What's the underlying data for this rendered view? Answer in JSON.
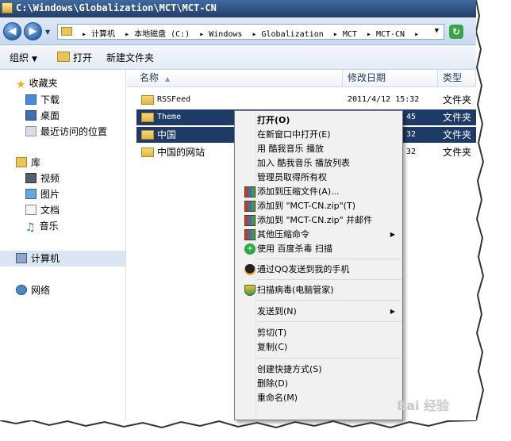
{
  "window": {
    "title": "C:\\Windows\\Globalization\\MCT\\MCT-CN"
  },
  "address_bar": {
    "crumbs": [
      "计算机",
      "本地磁盘 (C:)",
      "Windows",
      "Globalization",
      "MCT",
      "MCT-CN"
    ]
  },
  "toolbar": {
    "organize_label": "组织",
    "open_label": "打开",
    "new_folder_label": "新建文件夹"
  },
  "nav_pane": {
    "favorites": {
      "label": "收藏夹",
      "icon": "star-icon"
    },
    "favorites_items": [
      {
        "label": "下载",
        "icon": "downloads-icon"
      },
      {
        "label": "桌面",
        "icon": "desktop-icon"
      },
      {
        "label": "最近访问的位置",
        "icon": "recent-places-icon"
      }
    ],
    "libraries": {
      "label": "库",
      "icon": "library-icon"
    },
    "library_items": [
      {
        "label": "视频",
        "icon": "video-icon"
      },
      {
        "label": "图片",
        "icon": "picture-icon"
      },
      {
        "label": "文档",
        "icon": "document-icon"
      },
      {
        "label": "音乐",
        "icon": "music-icon"
      }
    ],
    "computer": {
      "label": "计算机",
      "icon": "computer-icon"
    },
    "network": {
      "label": "网络",
      "icon": "network-icon"
    }
  },
  "columns": {
    "name": "名称",
    "modified": "修改日期",
    "type": "类型"
  },
  "files": [
    {
      "name": "RSSFeed",
      "modified": "2011/4/12 15:32",
      "type": "文件夹",
      "selected": false
    },
    {
      "name": "Theme",
      "modified": "45",
      "type": "文件夹",
      "selected": true
    },
    {
      "name": "中国",
      "modified": "32",
      "type": "文件夹",
      "selected": true
    },
    {
      "name": "中国的网站",
      "modified": "32",
      "type": "文件夹",
      "selected": false
    }
  ],
  "context_menu": {
    "items": [
      {
        "label": "打开(O)",
        "bold": true
      },
      {
        "label": "在新窗口中打开(E)"
      },
      {
        "label": "用 酷我音乐 播放"
      },
      {
        "label": "加入 酷我音乐 播放列表"
      },
      {
        "label": "管理员取得所有权"
      },
      {
        "label": "添加到压缩文件(A)...",
        "icon": "winrar-icon"
      },
      {
        "label": "添加到 \"MCT-CN.zip\"(T)",
        "icon": "winrar-icon"
      },
      {
        "label": "添加到 \"MCT-CN.zip\" 并邮件",
        "icon": "winrar-icon"
      },
      {
        "label": "其他压缩命令",
        "icon": "winrar-icon",
        "submenu": true
      },
      {
        "label": "使用 百度杀毒 扫描",
        "icon": "baidu-antivirus-icon"
      },
      {
        "label": "通过QQ发送到我的手机",
        "icon": "qq-icon"
      },
      {
        "label": "扫描病毒(电脑管家)",
        "icon": "pc-manager-icon"
      },
      {
        "label": "发送到(N)",
        "submenu": true
      },
      {
        "label": "剪切(T)"
      },
      {
        "label": "复制(C)"
      },
      {
        "label": "创建快捷方式(S)"
      },
      {
        "label": "删除(D)"
      },
      {
        "label": "重命名(M)"
      }
    ]
  },
  "watermark": "Bai 经验",
  "colors": {
    "title_bar": "#233d66",
    "selection": "#1e3a66",
    "menu_bg": "#f1f1f1"
  }
}
